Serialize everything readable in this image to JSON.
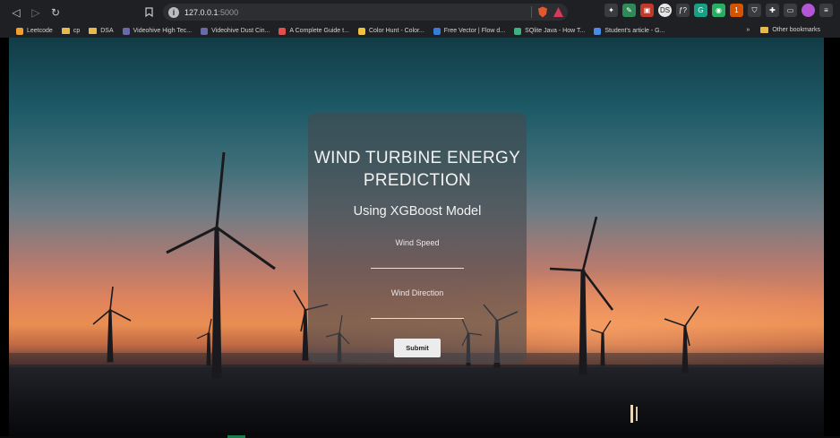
{
  "browser": {
    "url_host": "127.0.0.1",
    "url_port": ":5000"
  },
  "bookmarks": [
    {
      "label": "Leetcode",
      "color": "#f0a030"
    },
    {
      "label": "cp",
      "color": "#e8b84a",
      "folder": true
    },
    {
      "label": "DSA",
      "color": "#e8b84a",
      "folder": true
    },
    {
      "label": "Videohive High Tec...",
      "color": "#6a6aa8"
    },
    {
      "label": "Videohive Dust Cin...",
      "color": "#6a6aa8"
    },
    {
      "label": "A Complete Guide t...",
      "color": "#e05050"
    },
    {
      "label": "Color Hunt - Color...",
      "color": "#f0c040"
    },
    {
      "label": "Free Vector | Flow d...",
      "color": "#3a7ad8"
    },
    {
      "label": "SQlite Java - How T...",
      "color": "#40b080"
    },
    {
      "label": "Student's article - G...",
      "color": "#4a8ae8"
    }
  ],
  "bookmarks_right": {
    "more": "»",
    "other": "Other bookmarks"
  },
  "extensions": [
    {
      "name": "puzzle-ext-icon",
      "color": "#3a3b3f",
      "glyph": "✦"
    },
    {
      "name": "ext-green-icon",
      "color": "#2e8b57",
      "glyph": "✎"
    },
    {
      "name": "ext-red-icon",
      "color": "#c0392b",
      "glyph": "▣"
    },
    {
      "name": "ext-profile-ds-icon",
      "color": "#e6e6e6",
      "glyph": "DS"
    },
    {
      "name": "ext-fx-icon",
      "color": "#3a3b3f",
      "glyph": "ƒ?"
    },
    {
      "name": "ext-grammarly-icon",
      "color": "#16a085",
      "glyph": "G"
    },
    {
      "name": "ext-lime-icon",
      "color": "#27ae60",
      "glyph": "◉"
    },
    {
      "name": "ext-orange-icon",
      "color": "#d35400",
      "glyph": "1"
    },
    {
      "name": "ext-shield-icon",
      "color": "#3a3b3f",
      "glyph": "⛉"
    },
    {
      "name": "extensions-puzzle-icon",
      "color": "#3a3b3f",
      "glyph": "✚"
    },
    {
      "name": "wallet-icon",
      "color": "#3a3b3f",
      "glyph": "▭"
    },
    {
      "name": "profile-avatar-icon",
      "color": "#b455d8",
      "glyph": ""
    },
    {
      "name": "menu-icon",
      "color": "#3a3b3f",
      "glyph": "≡"
    }
  ],
  "form": {
    "title": "WIND TURBINE ENERGY PREDICTION",
    "subtitle": "Using XGBoost Model",
    "wind_speed_label": "Wind Speed",
    "wind_speed_value": "",
    "wind_direction_label": "Wind Direction",
    "wind_direction_value": "",
    "submit_label": "Submit"
  },
  "colors": {
    "card_bg": "rgba(70,72,78,0.62)",
    "chrome_bg": "#1f2023"
  }
}
